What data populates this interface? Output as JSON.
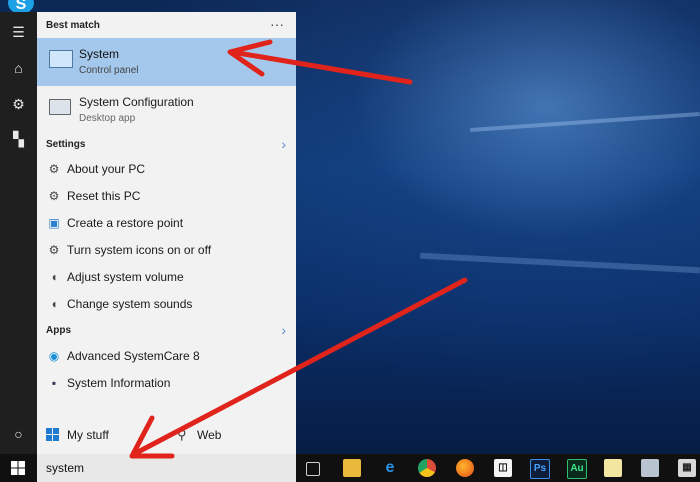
{
  "sidebar": {
    "icons": [
      "hamburger-icon",
      "home-icon",
      "settings-icon",
      "user-icon",
      "power-icon"
    ]
  },
  "startmenu": {
    "best_match_header": "Best match",
    "more_label": "···",
    "best_match": {
      "title": "System",
      "subtitle": "Control panel"
    },
    "second": {
      "title": "System Configuration",
      "subtitle": "Desktop app"
    },
    "settings_header": "Settings",
    "settings_items": [
      "About your PC",
      "Reset this PC",
      "Create a restore point",
      "Turn system icons on or off",
      "Adjust system volume",
      "Change system sounds"
    ],
    "apps_header": "Apps",
    "apps_items": [
      "Advanced SystemCare 8",
      "System Information"
    ],
    "my_stuff": "My stuff",
    "web": "Web"
  },
  "search": {
    "value": "system"
  },
  "taskbar": {
    "icons": [
      "task-view-icon",
      "file-explorer-icon",
      "edge-icon",
      "chrome-icon",
      "firefox-icon",
      "store-icon",
      "photoshop-icon",
      "audition-icon",
      "folder-icon",
      "app-icon",
      "calculator-icon"
    ],
    "ps_label": "Ps",
    "au_label": "Au"
  },
  "colors": {
    "highlight": "#a4c8ec",
    "accent": "#5a8fd1",
    "arrow": "#e0241c"
  }
}
